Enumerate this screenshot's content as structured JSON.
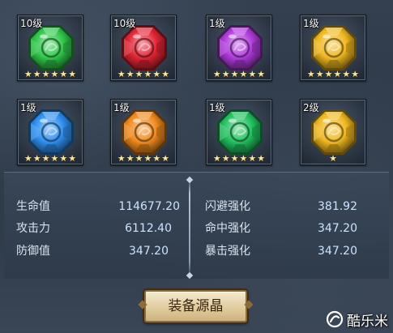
{
  "gems": [
    {
      "level": "10级",
      "color": "#2fc84a",
      "stars": 6
    },
    {
      "level": "10级",
      "color": "#e22535",
      "stars": 6
    },
    {
      "level": "1级",
      "color": "#b03bdc",
      "stars": 6
    },
    {
      "level": "1级",
      "color": "#f0b820",
      "stars": 6
    },
    {
      "level": "1级",
      "color": "#2e8ff0",
      "stars": 6
    },
    {
      "level": "1级",
      "color": "#f08a1e",
      "stars": 6
    },
    {
      "level": "1级",
      "color": "#22c260",
      "stars": 6
    },
    {
      "level": "2级",
      "color": "#f0b820",
      "stars": 1
    }
  ],
  "stats": {
    "left": [
      {
        "label": "生命值",
        "value": "114677.20"
      },
      {
        "label": "攻击力",
        "value": "6112.40"
      },
      {
        "label": "防御值",
        "value": "347.20"
      }
    ],
    "right": [
      {
        "label": "闪避强化",
        "value": "381.92"
      },
      {
        "label": "命中强化",
        "value": "347.20"
      },
      {
        "label": "暴击强化",
        "value": "347.20"
      }
    ]
  },
  "equip_button": {
    "label": "装备源晶"
  },
  "watermark": {
    "text": "酷乐米"
  }
}
